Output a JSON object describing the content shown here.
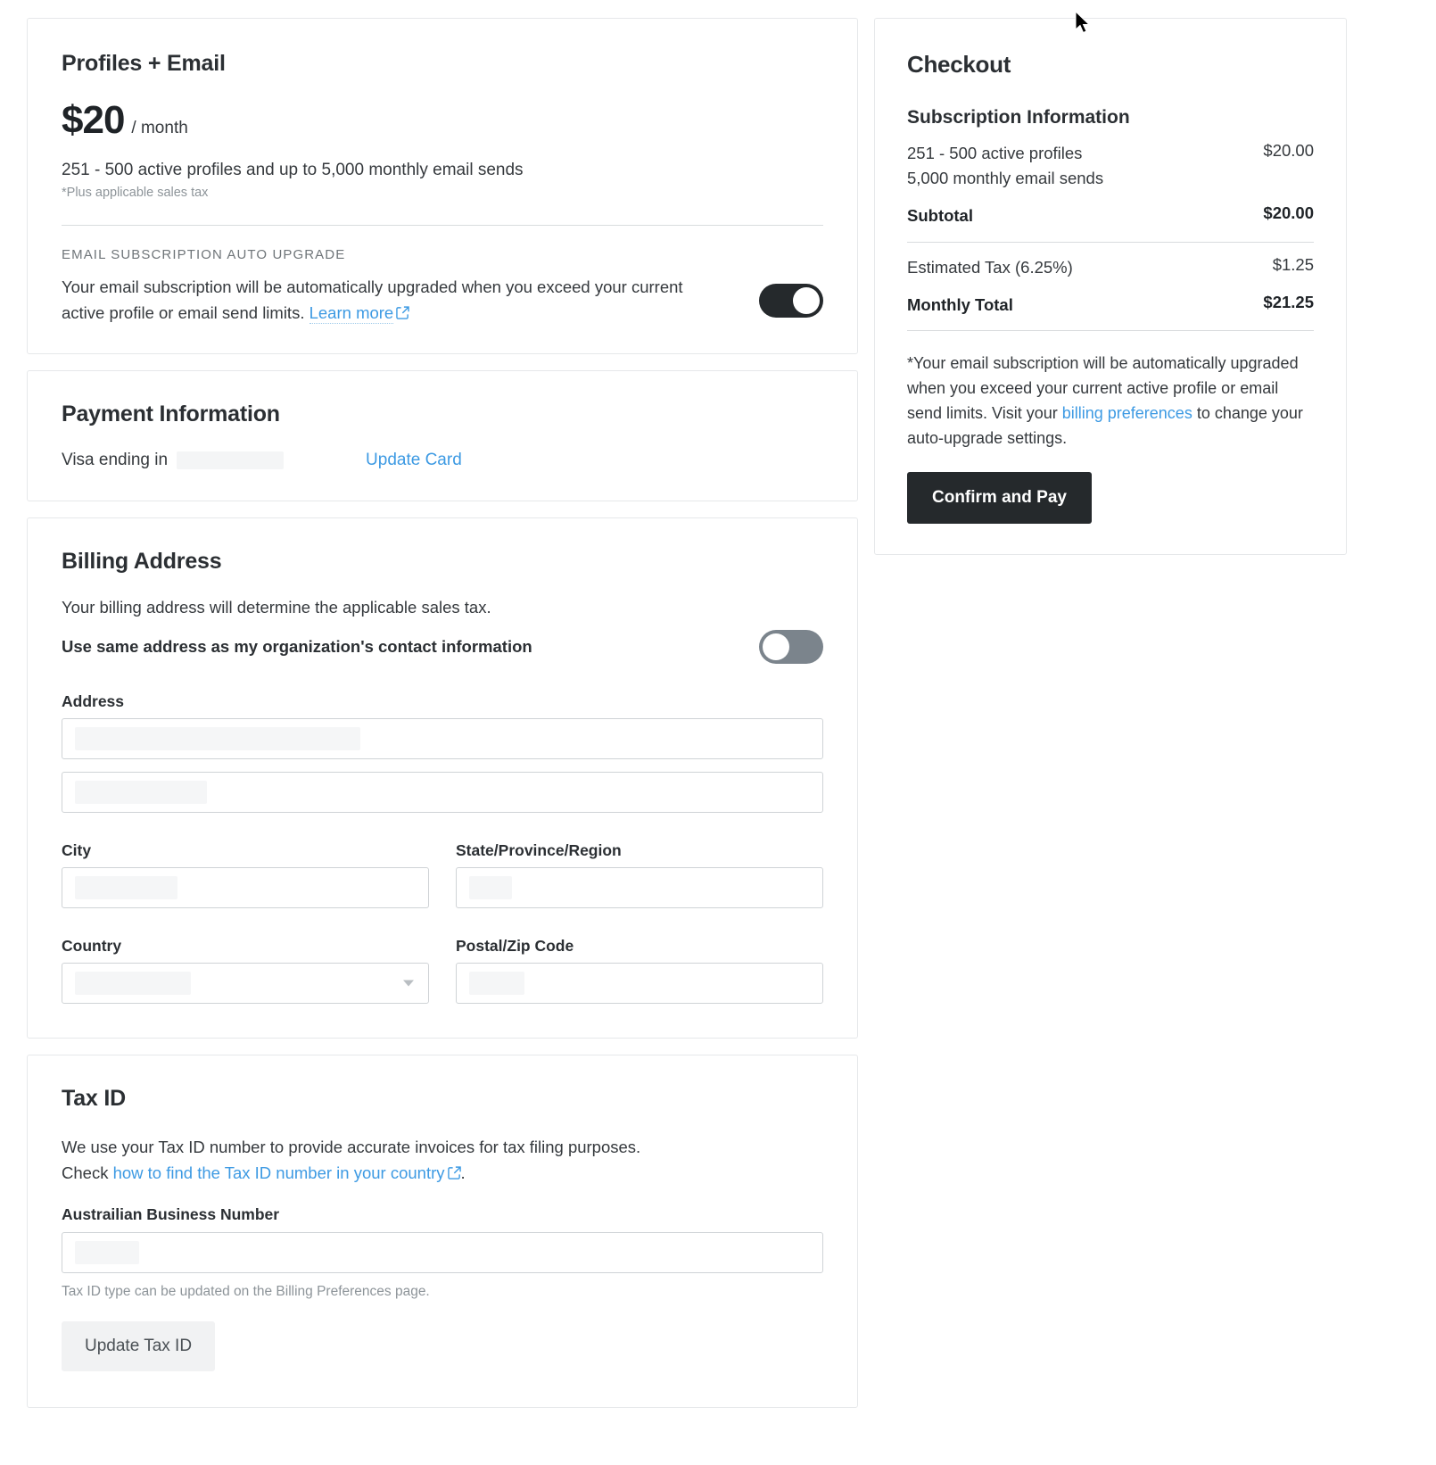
{
  "plan": {
    "title": "Profiles + Email",
    "price": "$20",
    "period": "/ month",
    "description": "251 - 500 active profiles and up to 5,000 monthly email sends",
    "tax_note": "*Plus applicable sales tax",
    "auto_upgrade_heading": "EMAIL SUBSCRIPTION AUTO UPGRADE",
    "auto_upgrade_text": "Your email subscription will be automatically upgraded when you exceed your current active profile or email send limits.",
    "learn_more_label": "Learn more",
    "auto_upgrade_toggle_state": "on"
  },
  "payment": {
    "title": "Payment Information",
    "card_label": "Visa ending in",
    "card_digits": "",
    "update_card_label": "Update Card"
  },
  "billing": {
    "title": "Billing Address",
    "description": "Your billing address will determine the applicable sales tax.",
    "same_address_label": "Use same address as my organization's contact information",
    "same_address_toggle_state": "off",
    "address_label": "Address",
    "address_line1_value": "",
    "address_line2_value": "",
    "city_label": "City",
    "city_value": "",
    "state_label": "State/Province/Region",
    "state_value": "",
    "country_label": "Country",
    "country_value": "",
    "postal_label": "Postal/Zip Code",
    "postal_value": ""
  },
  "tax_id": {
    "title": "Tax ID",
    "description_line1": "We use your Tax ID number to provide accurate invoices for tax filing purposes.",
    "description_check_prefix": "Check",
    "description_link": "how to find the Tax ID number in your country",
    "description_suffix": ".",
    "field_label": "Austrailian Business Number",
    "field_value": "",
    "hint": "Tax ID type can be updated on the Billing Preferences page.",
    "update_button_label": "Update Tax ID"
  },
  "checkout": {
    "title": "Checkout",
    "subscription_heading": "Subscription Information",
    "line_items": [
      {
        "label_line1": "251 - 500 active profiles",
        "label_line2": "5,000 monthly email sends",
        "value": "$20.00"
      }
    ],
    "subtotal_label": "Subtotal",
    "subtotal_value": "$20.00",
    "tax_label": "Estimated Tax (6.25%)",
    "tax_value": "$1.25",
    "total_label": "Monthly Total",
    "total_value": "$21.25",
    "note_part1": "*Your email subscription will be automatically upgraded when you exceed your current active profile or email send limits. Visit your ",
    "note_link": "billing preferences",
    "note_part2": " to change your auto-upgrade settings.",
    "confirm_button_label": "Confirm and Pay"
  },
  "colors": {
    "link": "#3d9ae3",
    "primary_button": "#25292c",
    "toggle_on": "#25292c",
    "toggle_off": "#7b848c",
    "border": "#e6e8ea"
  }
}
